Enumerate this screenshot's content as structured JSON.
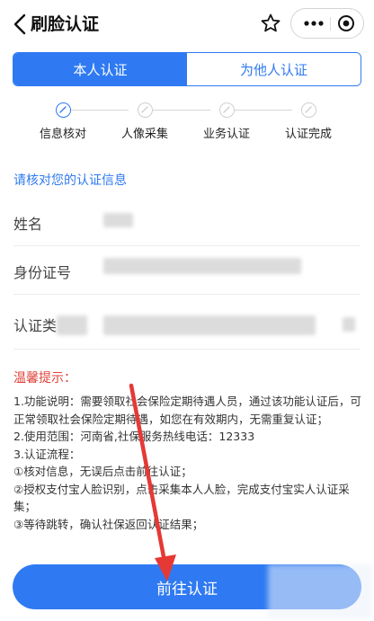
{
  "nav": {
    "title": "刷脸认证",
    "icons": [
      "back-icon",
      "star-icon",
      "more-icon",
      "target-icon"
    ]
  },
  "tabs": [
    {
      "label": "本人认证",
      "active": true
    },
    {
      "label": "为他人认证",
      "active": false
    }
  ],
  "steps": [
    {
      "label": "信息核对",
      "state": "active"
    },
    {
      "label": "人像采集",
      "state": "pending"
    },
    {
      "label": "业务认证",
      "state": "pending"
    },
    {
      "label": "认证完成",
      "state": "pending"
    }
  ],
  "form": {
    "title": "请核对您的认证信息",
    "name_label": "姓名",
    "id_label": "身份证号",
    "auth_label": "认证类"
  },
  "tips": {
    "title": "温馨提示：",
    "lines": [
      "1.功能说明：需要领取社会保险定期待遇人员，通过该功能认证后，可正常领取社会保险定期待遇，如您在有效期内，无需重复认证；",
      "2.使用范围：河南省,社保服务热线电话：12333",
      "3.认证流程：",
      "①核对信息，无误后点击前往认证；",
      "②授权支付宝人脸识别，点击采集本人人脸，完成支付宝实人认证采集；",
      "③等待跳转，确认社保返回认证结果；"
    ]
  },
  "cta": {
    "label": "前往认证"
  },
  "colors": {
    "accent": "#2f7af2",
    "warning": "#e0423a",
    "annotation_arrow": "#e53935"
  }
}
